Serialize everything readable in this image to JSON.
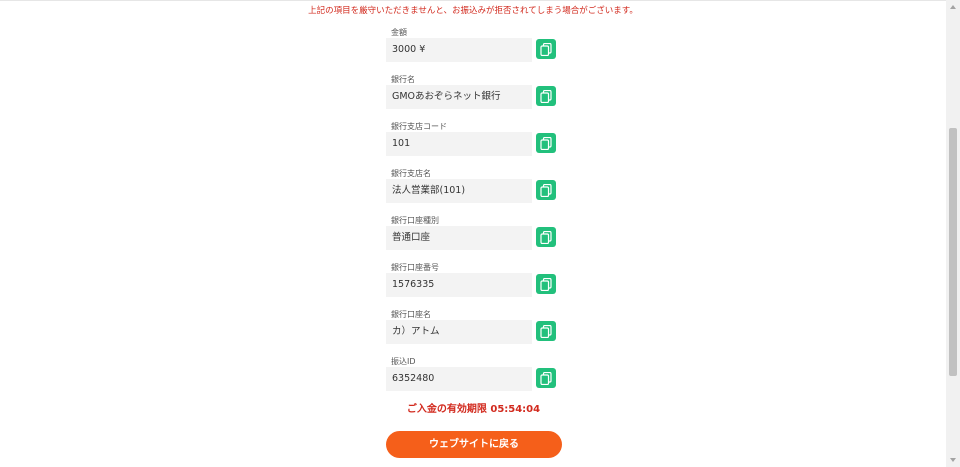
{
  "notice": "上記の項目を厳守いただきませんと、お振込みが拒否されてしまう場合がございます。",
  "fields": [
    {
      "label": "金額",
      "value": "3000 ¥"
    },
    {
      "label": "銀行名",
      "value": "GMOあおぞらネット銀行"
    },
    {
      "label": "銀行支店コード",
      "value": "101"
    },
    {
      "label": "銀行支店名",
      "value": "法人営業部(101)"
    },
    {
      "label": "銀行口座種別",
      "value": "普通口座"
    },
    {
      "label": "銀行口座番号",
      "value": "1576335"
    },
    {
      "label": "銀行口座名",
      "value": "カ）アトム"
    },
    {
      "label": "振込ID",
      "value": "6352480"
    }
  ],
  "copy_icon": "copy-icon",
  "expiry": "ご入金の有効期限 05:54:04",
  "back_button": "ウェブサイトに戻る",
  "colors": {
    "accent_green": "#22c07c",
    "warning_red": "#d22a1e",
    "button_orange": "#f55f1a"
  }
}
